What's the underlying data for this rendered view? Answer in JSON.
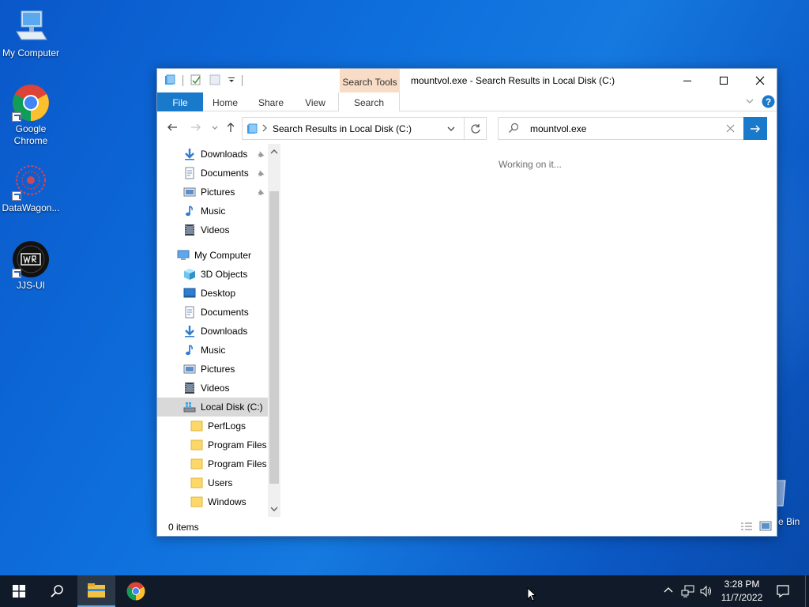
{
  "desktop": {
    "icons": [
      {
        "label": "My Computer"
      },
      {
        "label": "Google Chrome"
      },
      {
        "label": "DataWagon..."
      },
      {
        "label": "JJS-UI"
      }
    ],
    "recycle_bin_partial_label": "e Bin"
  },
  "window": {
    "title": "mountvol.exe - Search Results in Local Disk (C:)",
    "contextual_tab": "Search Tools",
    "ribbon_tabs": [
      "File",
      "Home",
      "Share",
      "View",
      "Search"
    ],
    "address": "Search Results in Local Disk (C:)",
    "search_value": "mountvol.exe",
    "content_message": "Working on it...",
    "status": "0 items"
  },
  "nav": {
    "quick_access": [
      {
        "label": "Downloads",
        "icon": "download-icon",
        "pinned": true
      },
      {
        "label": "Documents",
        "icon": "document-icon",
        "pinned": true
      },
      {
        "label": "Pictures",
        "icon": "pictures-icon",
        "pinned": true
      },
      {
        "label": "Music",
        "icon": "music-icon",
        "pinned": false
      },
      {
        "label": "Videos",
        "icon": "videos-icon",
        "pinned": false
      }
    ],
    "this_pc": "My Computer",
    "pc_items": [
      {
        "label": "3D Objects",
        "icon": "3d-objects-icon"
      },
      {
        "label": "Desktop",
        "icon": "desktop-icon"
      },
      {
        "label": "Documents",
        "icon": "document-icon"
      },
      {
        "label": "Downloads",
        "icon": "download-icon"
      },
      {
        "label": "Music",
        "icon": "music-icon"
      },
      {
        "label": "Pictures",
        "icon": "pictures-icon"
      },
      {
        "label": "Videos",
        "icon": "videos-icon"
      },
      {
        "label": "Local Disk (C:)",
        "icon": "drive-icon",
        "selected": true
      }
    ],
    "drive_folders": [
      "PerfLogs",
      "Program Files",
      "Program Files (",
      "Users",
      "Windows"
    ]
  },
  "taskbar": {
    "time": "3:28 PM",
    "date": "11/7/2022"
  },
  "colors": {
    "accent": "#1979ca",
    "search_tools_tab": "#f9dcc5",
    "taskbar": "#101a28"
  }
}
